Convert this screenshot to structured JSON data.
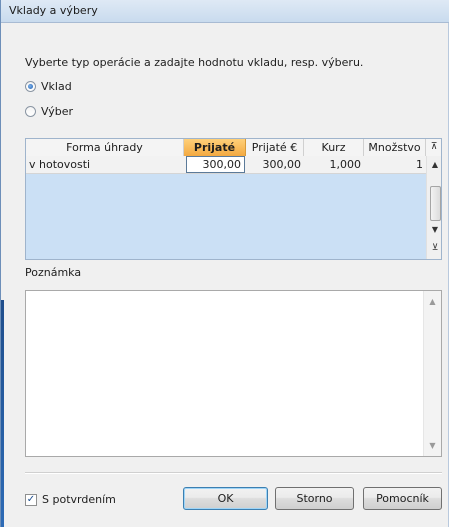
{
  "window": {
    "title": "Vklady a výbery"
  },
  "instruction": "Vyberte typ operácie a zadajte hodnotu vkladu, resp. výberu.",
  "operation_type": {
    "options": [
      {
        "label": "Vklad",
        "checked": true
      },
      {
        "label": "Výber",
        "checked": false
      }
    ]
  },
  "grid": {
    "columns": [
      "Forma úhrady",
      "Prijaté",
      "Prijaté €",
      "Kurz",
      "Množstvo"
    ],
    "active_column": "Prijaté",
    "rows": [
      {
        "forma_uhrady": "v hotovosti",
        "prijate": "300,00",
        "prijate_eur": "300,00",
        "kurz": "1,000",
        "mnozstvo": "1"
      }
    ]
  },
  "note": {
    "label": "Poznámka",
    "value": ""
  },
  "footer": {
    "confirm_checkbox": {
      "label": "S potvrdením",
      "checked": true
    },
    "ok_label": "OK",
    "cancel_label": "Storno",
    "help_label": "Pomocník"
  },
  "colors": {
    "active_header": "#f3a941",
    "grid_background": "#cbe0f5",
    "title_bar": "#c9dbee"
  }
}
